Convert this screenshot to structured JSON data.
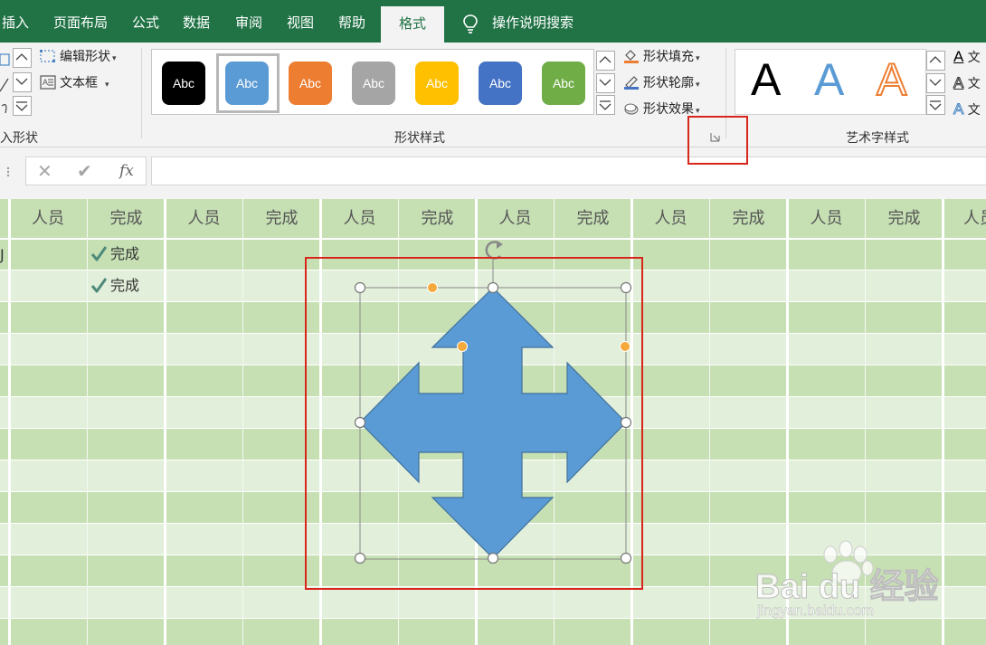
{
  "tabs": [
    {
      "label": "插入"
    },
    {
      "label": "页面布局"
    },
    {
      "label": "公式"
    },
    {
      "label": "数据"
    },
    {
      "label": "审阅"
    },
    {
      "label": "视图"
    },
    {
      "label": "帮助"
    },
    {
      "label": "格式",
      "active": true
    }
  ],
  "search_label": "操作说明搜索",
  "ribbon": {
    "insert_shapes": {
      "edit_shape": "编辑形状",
      "text_box": "文本框",
      "group_label": "入形状"
    },
    "shape_styles": {
      "swatches": [
        {
          "label": "Abc",
          "color": "#000000"
        },
        {
          "label": "Abc",
          "color": "#5b9bd5",
          "selected": true
        },
        {
          "label": "Abc",
          "color": "#ed7d31"
        },
        {
          "label": "Abc",
          "color": "#a5a5a5"
        },
        {
          "label": "Abc",
          "color": "#ffc000"
        },
        {
          "label": "Abc",
          "color": "#4472c4"
        },
        {
          "label": "Abc",
          "color": "#70ad47"
        }
      ],
      "shape_fill": "形状填充",
      "shape_outline": "形状轮廓",
      "shape_effects": "形状效果",
      "group_label": "形状样式"
    },
    "wordart": {
      "samples": [
        {
          "label": "A",
          "style": "black"
        },
        {
          "label": "A",
          "style": "blue-gradient"
        },
        {
          "label": "A",
          "style": "orange-outline"
        }
      ],
      "text_fill": "文",
      "text_outline": "文",
      "text_effects": "文",
      "group_label": "艺术字样式"
    }
  },
  "formula_bar": {
    "cancel": "✕",
    "enter": "✔",
    "fx": "fx",
    "value": ""
  },
  "sheet": {
    "headers": [
      "人员",
      "完成",
      "人员",
      "完成",
      "人员",
      "完成",
      "人员",
      "完成",
      "人员",
      "完成",
      "人员",
      "完成",
      "人员"
    ],
    "left_fragment": "J",
    "done_cells": [
      {
        "text": "完成"
      },
      {
        "text": "完成"
      }
    ]
  },
  "shape": {
    "type": "four-way-arrow",
    "fill": "#5b9bd5",
    "stroke": "#41719c"
  },
  "colors": {
    "brand": "#217346",
    "highlight": "#d9261c"
  },
  "watermark": {
    "logo": "Bai du 经验",
    "url": "jingyan.baidu.com"
  }
}
